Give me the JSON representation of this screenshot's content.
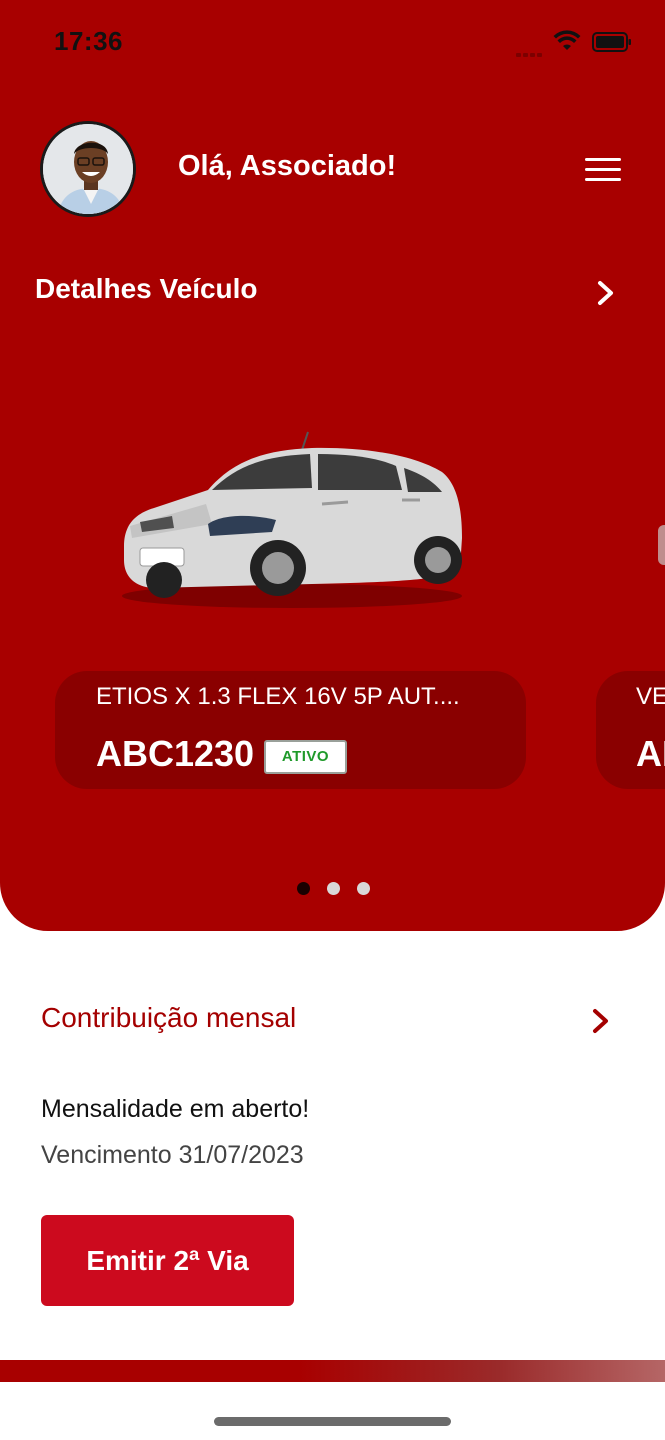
{
  "status_bar": {
    "time": "17:36"
  },
  "header": {
    "greeting": "Olá, Associado!"
  },
  "vehicle_section": {
    "title": "Detalhes Veículo"
  },
  "vehicles": [
    {
      "model": "ETIOS X 1.3 FLEX 16V 5P AUT....",
      "plate": "ABC1230",
      "status": "ATIVO"
    },
    {
      "model": "VE",
      "plate": "AI"
    }
  ],
  "pager": {
    "count": 3,
    "active_index": 0
  },
  "contribution": {
    "title": "Contribuição mensal",
    "status_text": "Mensalidade em aberto!",
    "due_text": "Vencimento 31/07/2023",
    "button_label": "Emitir 2ª Via"
  },
  "colors": {
    "primary_red": "#a80000",
    "card_red": "#8a0000",
    "button_red": "#cc0a1e",
    "active_green": "#1f9a2a"
  },
  "icons": [
    "wifi-icon",
    "battery-icon",
    "menu-icon",
    "chevron-right-icon",
    "avatar-photo"
  ]
}
